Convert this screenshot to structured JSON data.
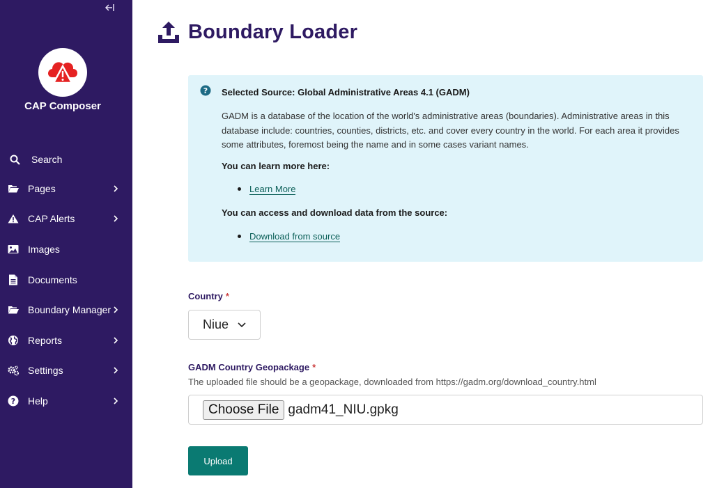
{
  "sidebar": {
    "brand": "CAP Composer",
    "search_label": "Search",
    "items": [
      {
        "label": "Pages",
        "icon": "folder-open-icon",
        "has_submenu": true
      },
      {
        "label": "CAP Alerts",
        "icon": "warning-icon",
        "has_submenu": true
      },
      {
        "label": "Images",
        "icon": "image-icon",
        "has_submenu": false
      },
      {
        "label": "Documents",
        "icon": "document-icon",
        "has_submenu": false
      },
      {
        "label": "Boundary Manager",
        "icon": "folder-open-icon",
        "has_submenu": true
      },
      {
        "label": "Reports",
        "icon": "globe-icon",
        "has_submenu": true
      },
      {
        "label": "Settings",
        "icon": "cogs-icon",
        "has_submenu": true
      },
      {
        "label": "Help",
        "icon": "help-circle-icon",
        "has_submenu": true
      }
    ]
  },
  "header": {
    "title": "Boundary Loader",
    "icon": "upload-icon"
  },
  "info_panel": {
    "title": "Selected Source: Global Administrative Areas 4.1 (GADM)",
    "description": "GADM is a database of the location of the world's administrative areas (boundaries). Administrative areas in this database include: countries, counties, districts, etc. and cover every country in the world. For each area it provides some attributes, foremost being the name and in some cases variant names.",
    "learn_more_heading": "You can learn more here:",
    "learn_more_link": "Learn More",
    "download_heading": "You can access and download data from the source:",
    "download_link": "Download from source"
  },
  "form": {
    "country_label": "Country",
    "country_value": "Niue",
    "required_mark": "*",
    "geopackage_label": "GADM Country Geopackage",
    "geopackage_help": "The uploaded file should be a geopackage, downloaded from https://gadm.org/download_country.html",
    "choose_file_label": "Choose File",
    "file_name": "gadm41_NIU.gpkg",
    "upload_label": "Upload"
  },
  "colors": {
    "sidebar_bg": "#2e1a62",
    "title_color": "#2e1a62",
    "info_bg": "#e0f4fa",
    "link_color": "#0b5f58",
    "button_bg": "#0a7a72",
    "required_color": "#cd4444",
    "logo_alert_red": "#e52222"
  }
}
